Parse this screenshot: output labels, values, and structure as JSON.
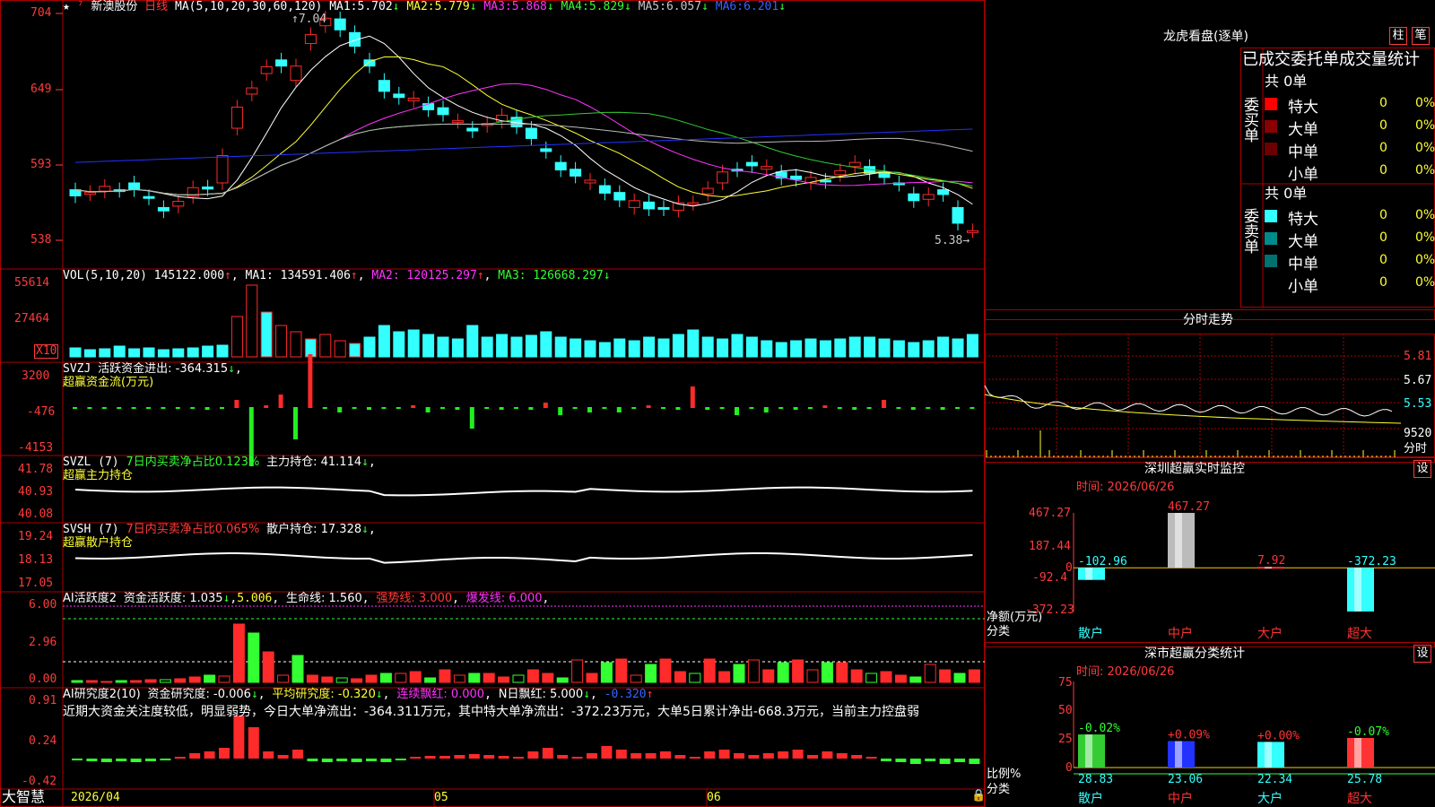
{
  "colors": {
    "up": "#ff2a2a",
    "down": "#33ffff",
    "ma1": "#ffffff",
    "ma2": "#ffff33",
    "ma3": "#ff33ff",
    "ma4": "#33cc33",
    "ma5": "#bbbbbb",
    "ma6": "#2233ff",
    "grid": "#aa0000",
    "axis": "#ff4040"
  },
  "stock": {
    "name": "新澳股份",
    "period": "日线",
    "ma_params": "MA(5,10,20,30,60,120)",
    "ma": [
      {
        "label": "MA1:",
        "value": "5.702",
        "arrow": "↓"
      },
      {
        "label": "MA2:",
        "value": "5.779",
        "arrow": "↓"
      },
      {
        "label": "MA3:",
        "value": "5.868",
        "arrow": "↓"
      },
      {
        "label": "MA4:",
        "value": "5.829",
        "arrow": "↓"
      },
      {
        "label": "MA5:",
        "value": "6.057",
        "arrow": "↓"
      },
      {
        "label": "MA6:",
        "value": "6.201",
        "arrow": "↓"
      }
    ],
    "high_label": "7.04",
    "low_label": "5.38",
    "price_ticks": [
      "704",
      "649",
      "593",
      "538"
    ]
  },
  "vol": {
    "header": "VOL(5,10,20)",
    "value": "145122.000",
    "ma1": "MA1: 134591.406",
    "ma2": "MA2: 120125.297",
    "ma3": "MA3: 126668.297",
    "ticks": [
      "55614",
      "27464"
    ],
    "unit": "X10"
  },
  "svzj": {
    "header": "SVZJ",
    "sub": "活跃资金进出: -364.315",
    "subtitle": "超赢资金流(万元)",
    "ticks": [
      "3200",
      "-476",
      "-4153"
    ]
  },
  "svzl": {
    "header": "SVZL (7)",
    "desc": "7日内买卖净占比0.123%",
    "main": "主力持仓: 41.114",
    "subtitle": "超赢主力持仓",
    "ticks": [
      "41.78",
      "40.93",
      "40.08"
    ]
  },
  "svsh": {
    "header": "SVSH (7)",
    "desc": "7日内买卖净占比0.065%",
    "main": "散户持仓: 17.328",
    "subtitle": "超赢散户持仓",
    "ticks": [
      "19.24",
      "18.13",
      "17.05"
    ]
  },
  "ai1": {
    "header": "AI活跃度2",
    "a": "资金活跃度: 1.035",
    "b": "5.006",
    "c": "生命线: 1.560",
    "d": "强势线: 3.000",
    "e": "爆发线: 6.000",
    "ticks": [
      "6.00",
      "2.96",
      "0.00"
    ]
  },
  "ai2": {
    "header": "AI研究度2(10)",
    "a": "资金研究度: -0.006",
    "b": "平均研究度: -0.320",
    "c": "连续飘红: 0.000",
    "d": "N日飘红: 5.000",
    "e": "-0.320",
    "ticks": [
      "0.91",
      "0.24",
      "-0.42"
    ],
    "comment": "近期大资金关注度较低，明显弱势，今日大单净流出：-364.311万元，其中特大单净流出：-372.23万元，大单5日累计净出-668.3万元，当前主力控盘弱"
  },
  "timeline": {
    "date": "2026/04",
    "months": [
      "05",
      "06"
    ],
    "brand": "大智慧"
  },
  "dragon": {
    "title": "龙虎看盘(逐单)",
    "btn1": "柱",
    "btn2": "笔",
    "tabs": "已成交委托单成交量统计",
    "buy": {
      "side": "委买单",
      "total": "共 0单",
      "rows": [
        {
          "name": "特大",
          "qty": "0",
          "pct": "0%",
          "color": "#ff0000"
        },
        {
          "name": "大单",
          "qty": "0",
          "pct": "0%",
          "color": "#8b0000"
        },
        {
          "name": "中单",
          "qty": "0",
          "pct": "0%",
          "color": "#6b0000"
        },
        {
          "name": "小单",
          "qty": "0",
          "pct": "0%",
          "color": ""
        }
      ]
    },
    "sell": {
      "side": "委卖单",
      "total": "共 0单",
      "rows": [
        {
          "name": "特大",
          "qty": "0",
          "pct": "0%",
          "color": "#33ffff"
        },
        {
          "name": "大单",
          "qty": "0",
          "pct": "0%",
          "color": "#008b8b"
        },
        {
          "name": "中单",
          "qty": "0",
          "pct": "0%",
          "color": "#007070"
        },
        {
          "name": "小单",
          "qty": "0",
          "pct": "0%",
          "color": ""
        }
      ]
    }
  },
  "intraday": {
    "title": "分时走势",
    "ticks": [
      "5.81",
      "5.67",
      "5.53",
      "9520",
      "分时"
    ]
  },
  "monitor": {
    "title": "深圳超赢实时监控",
    "btn": "设",
    "time": "时间: 2026/06/26",
    "ticks": [
      "467.27",
      "187.44",
      "0",
      "-92.4",
      "-372.23"
    ],
    "ylabel": "净额(万元)",
    "xlabel": "分类"
  },
  "stats": {
    "title": "深市超赢分类统计",
    "btn": "设",
    "time": "时间: 2026/06/26",
    "ticks": [
      "75",
      "50",
      "25",
      "0"
    ],
    "ylabel": "比例%",
    "xlabel": "分类"
  },
  "chart_data": [
    {
      "type": "bar",
      "title": "深圳超赢实时监控",
      "categories": [
        "散户",
        "中户",
        "大户",
        "超大"
      ],
      "values": [
        -102.96,
        467.27,
        7.92,
        -372.23
      ],
      "ylabel": "净额(万元)",
      "xlabel": "分类",
      "ylim": [
        -372.23,
        467.27
      ]
    },
    {
      "type": "bar",
      "title": "深市超赢分类统计",
      "categories": [
        "散户",
        "中户",
        "大户",
        "超大"
      ],
      "values": [
        28.83,
        23.06,
        22.34,
        25.78
      ],
      "deltas": [
        "-0.02%",
        "+0.09%",
        "+0.00%",
        "-0.07%"
      ],
      "ylabel": "比例%",
      "xlabel": "分类",
      "ylim": [
        0,
        75
      ]
    }
  ]
}
